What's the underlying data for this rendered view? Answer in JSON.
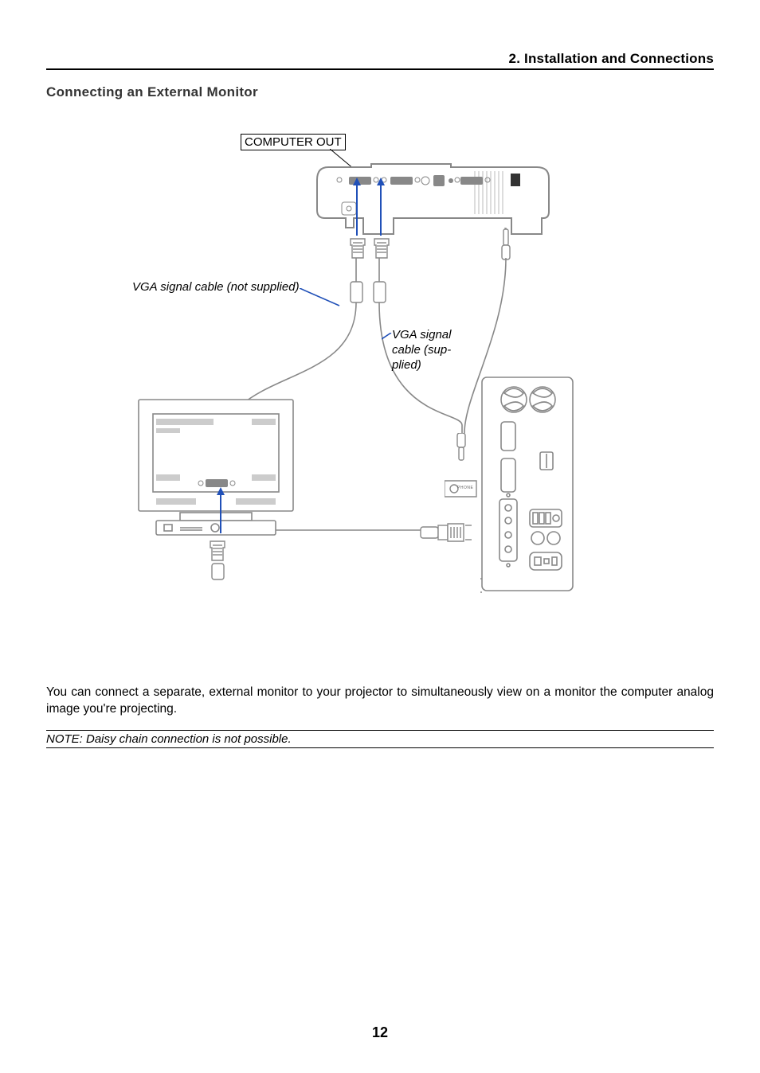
{
  "header": {
    "chapter": "2. Installation and Connections"
  },
  "section": {
    "title": "Connecting an External Monitor"
  },
  "labels": {
    "port": "COMPUTER OUT",
    "vga_not_supplied": "VGA signal cable (not supplied)",
    "vga_supplied": "VGA signal\ncable (sup-\nplied)",
    "tiny_port": "PHONE"
  },
  "body": {
    "paragraph": "You can connect a separate, external monitor to your projector to simultaneously view on a monitor the computer analog image you're projecting."
  },
  "note": {
    "text": "NOTE: Daisy chain connection is not possible."
  },
  "page_number": "12"
}
